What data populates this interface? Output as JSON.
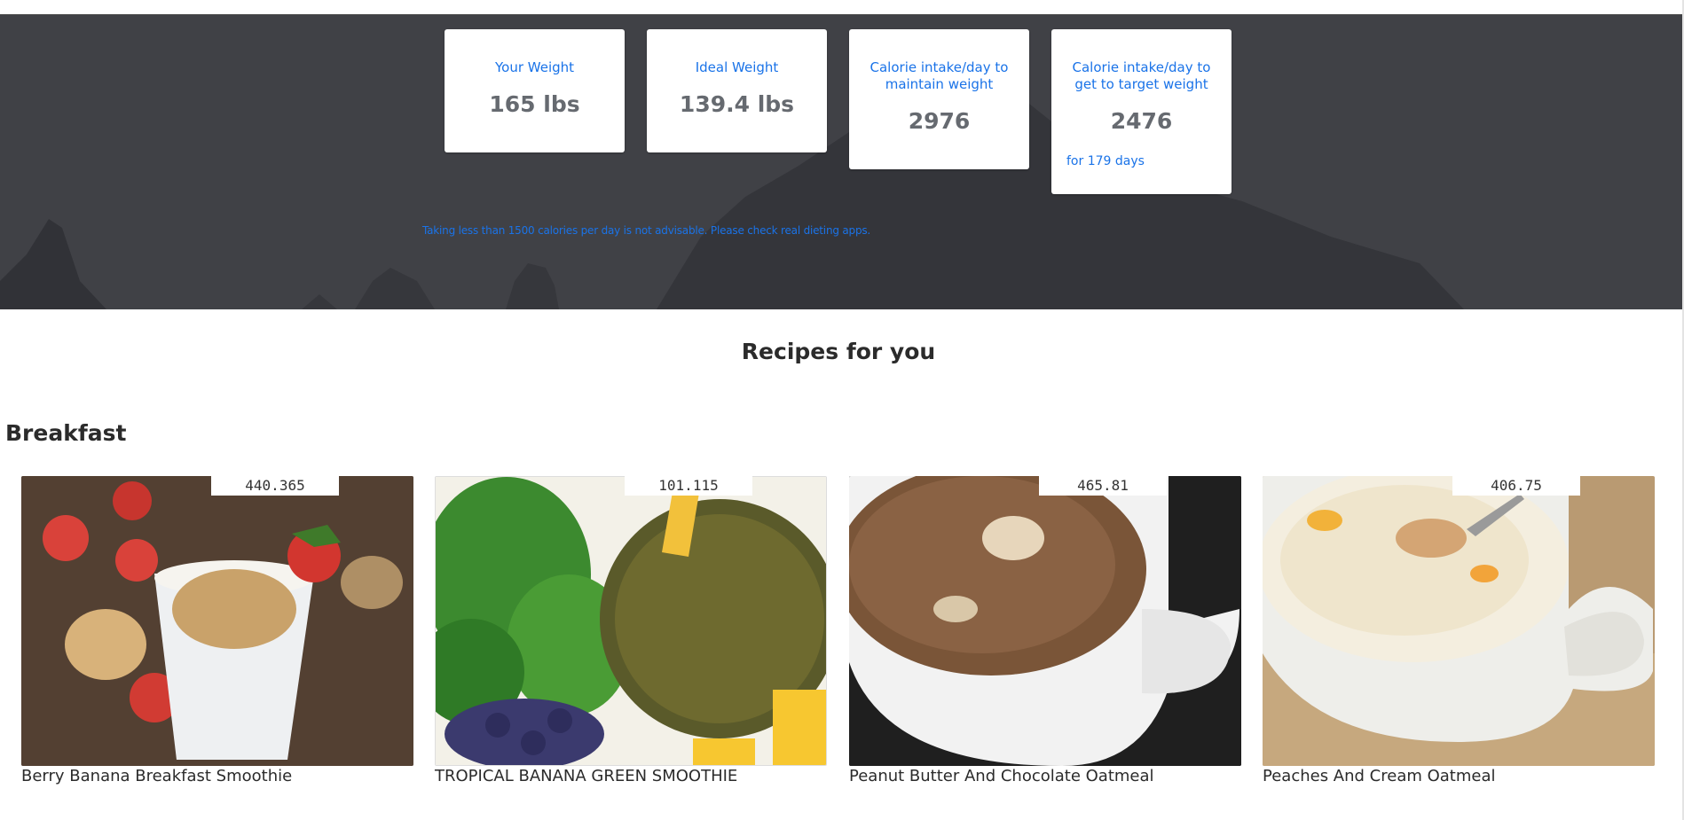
{
  "stats": {
    "your_weight": {
      "title": "Your Weight",
      "value": "165 lbs"
    },
    "ideal_weight": {
      "title": "Ideal Weight",
      "value": "139.4 lbs"
    },
    "maintain": {
      "title": "Calorie intake/day to maintain weight",
      "value": "2976"
    },
    "target": {
      "title": "Calorie intake/day to get to target weight",
      "value": "2476",
      "note": "for 179 days"
    }
  },
  "warning": "Taking less than 1500 calories per day is not advisable. Please check real dieting apps.",
  "recipes_title": "Recipes for you",
  "category": "Breakfast",
  "recipes": [
    {
      "calories": "440.365",
      "name": "Berry Banana Breakfast Smoothie"
    },
    {
      "calories": "101.115",
      "name": "TROPICAL BANANA GREEN SMOOTHIE"
    },
    {
      "calories": "465.81",
      "name": "Peanut Butter And Chocolate Oatmeal"
    },
    {
      "calories": "406.75",
      "name": "Peaches And Cream Oatmeal"
    }
  ],
  "colors": {
    "accent": "#1a73e8",
    "hero_bg": "#3f4045",
    "value_text": "#666a70"
  }
}
